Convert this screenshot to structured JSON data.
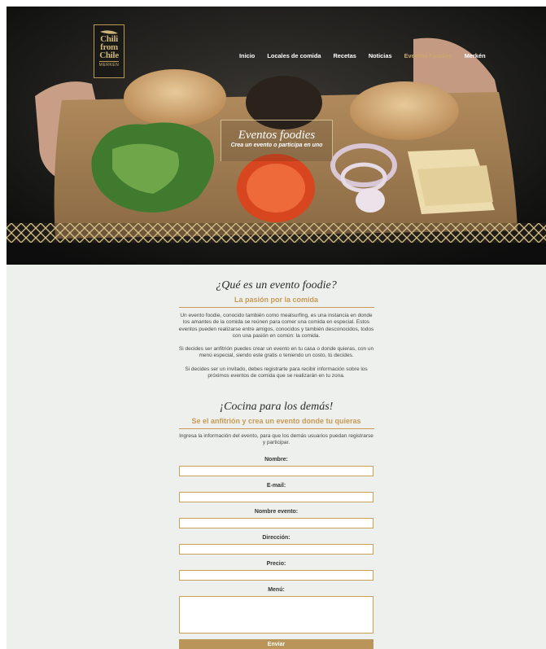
{
  "logo": {
    "line1": "Chili",
    "line2": "from",
    "line3": "Chile",
    "line4": "MERKÉN"
  },
  "nav": {
    "items": [
      {
        "label": "Inicio",
        "active": false
      },
      {
        "label": "Locales de comida",
        "active": false
      },
      {
        "label": "Recetas",
        "active": false
      },
      {
        "label": "Noticias",
        "active": false
      },
      {
        "label": "Eventos Foodies",
        "active": true
      },
      {
        "label": "Merkén",
        "active": false
      }
    ]
  },
  "hero": {
    "title": "Eventos foodies",
    "subtitle": "Crea un evento o participa en uno"
  },
  "about": {
    "title": "¿Qué es un evento foodie?",
    "subtitle": "La pasión por la comida",
    "paragraphs": [
      "Un evento foodie, conocido también como mealsurfing, es una instancia en donde los amantes de la comida se reúnen para comer una comida en especial. Estos eventos pueden realizarse entre amigos, conocidos y también desconocidos, todos con una pasión en común: la comida.",
      "Si decides ser anfitrión puedes crear un evento en tu casa o donde quieras, con un menú especial, siendo este gratis o teniendo un costo, tú decides.",
      "Si decides ser un invitado, debes registrarte para recibir información sobre los próximos eventos de comida que se realizarán en tu zona."
    ]
  },
  "cook": {
    "title": "¡Cocina para los demás!",
    "subtitle": "Se el anfitrión y crea un evento donde tu quieras",
    "intro": "Ingresa la información del evento, para que los demás usuarios puedan registrarse y participar."
  },
  "form": {
    "nombre_label": "Nombre:",
    "email_label": "E-mail:",
    "evento_label": "Nombre evento:",
    "direccion_label": "Dirección:",
    "precio_label": "Precio:",
    "menu_label": "Menú:",
    "submit_label": "Enviar"
  },
  "colors": {
    "accent": "#c79a55",
    "active_nav": "#c9a96a",
    "background": "#eef0ee"
  }
}
